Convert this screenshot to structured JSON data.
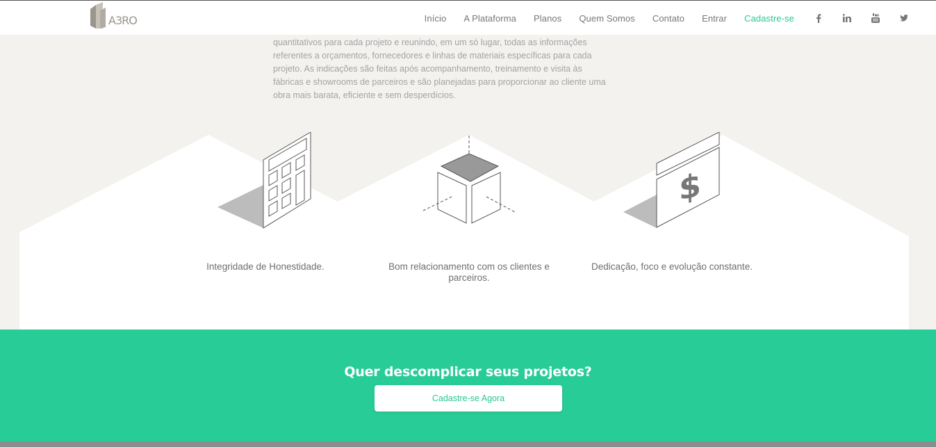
{
  "header": {
    "logo_text": "A3RO",
    "nav": [
      {
        "label": "Início",
        "name": "nav-inicio"
      },
      {
        "label": "A Plataforma",
        "name": "nav-a-plataforma"
      },
      {
        "label": "Planos",
        "name": "nav-planos"
      },
      {
        "label": "Quem Somos",
        "name": "nav-quem-somos"
      },
      {
        "label": "Contato",
        "name": "nav-contato"
      },
      {
        "label": "Entrar",
        "name": "nav-entrar"
      },
      {
        "label": "Cadastre-se",
        "name": "nav-cadastre-se"
      }
    ],
    "social": [
      "facebook-icon",
      "linkedin-icon",
      "youtube-icon",
      "twitter-icon"
    ]
  },
  "about": {
    "text": "quantitativos para cada projeto e reunindo, em um só lugar, todas as informações referentes a orçamentos, fornecedores e linhas de materiais específicas para cada projeto. As indicações são feitas após acompanhamento, treinamento e visita às fábricas e showrooms de parceiros e são planejadas para proporcionar ao cliente uma obra mais barata, eficiente e sem desperdícios."
  },
  "values": [
    {
      "label": "Integridade de Honestidade.",
      "icon": "calculator-icon"
    },
    {
      "label": "Bom relacionamento com os clientes e parceiros.",
      "icon": "cube-icon"
    },
    {
      "label": "Dedicação, foco e evolução constante.",
      "icon": "dollar-bill-icon"
    }
  ],
  "cta": {
    "title": "Quer descomplicar seus projetos?",
    "button_label": "Cadastre-se Agora"
  },
  "colors": {
    "accent": "#28cc96",
    "background": "#f3f2ef",
    "panel": "#ffffff",
    "text": "#6f6f6f"
  }
}
